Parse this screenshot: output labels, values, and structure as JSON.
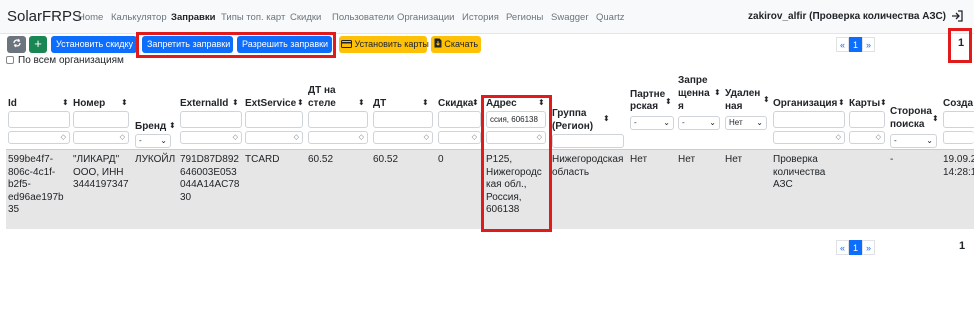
{
  "navbar": {
    "brand": "SolarFRPS",
    "items": [
      "Home",
      "Калькулятор",
      "Заправки",
      "Типы топ. карт",
      "Скидки",
      "Пользователи",
      "Организации",
      "История",
      "Регионы",
      "Swagger",
      "Quartz"
    ],
    "active_item": "Заправки",
    "user": "zakirov_alfir (Проверка количества АЗС)",
    "logout_icon": "logout-icon"
  },
  "toolbar": {
    "refresh_icon": "refresh-icon",
    "add_label": "+",
    "set_discount": "Установить скидку",
    "forbid_stations": "Запретить заправки",
    "allow_stations": "Разрешить заправки",
    "set_cards": "Установить карты",
    "download": "Скачать",
    "all_orgs_label": "По всем организациям"
  },
  "pagination": {
    "prev": "«",
    "current": "1",
    "next": "»",
    "total_pages": "1"
  },
  "table": {
    "columns": {
      "id": "Id",
      "number": "Номер",
      "brand": "Бренд",
      "external_id": "ExternalId",
      "ext_service": "ExtService",
      "dt_stela_1": "ДТ на",
      "dt_stela_2": "стеле",
      "dt": "ДТ",
      "discount": "Скидка",
      "address": "Адрес",
      "group_1": "Группа",
      "group_2": "(Регион)",
      "partner_1": "Партне",
      "partner_2": "рская",
      "forbidden_1": "Запре",
      "forbidden_2": "щенна",
      "forbidden_3": "я",
      "deleted_1": "Удален",
      "deleted_2": "ная",
      "organization": "Организация",
      "cards": "Карты",
      "side_1": "Сторона",
      "side_2": "поиска",
      "created": "Созда"
    },
    "filters": {
      "address_value": "ссия, 606138",
      "brand_select": "-",
      "partner_select": "-",
      "forbidden_select": "-",
      "deleted_select": "Нет",
      "side_select": "-"
    },
    "rows": [
      {
        "id": [
          "599be4f7-",
          "806c-4c1f-",
          "b2f5-",
          "ed96ae197b",
          "35"
        ],
        "number": [
          "\"ЛИКАРД\"",
          "ООО, ИНН",
          "3444197347"
        ],
        "brand": "ЛУКОЙЛ",
        "external_id": [
          "791D87D892",
          "646003E053",
          "044A14AC78",
          "30"
        ],
        "ext_service": "TCARD",
        "dt_stela": "60.52",
        "dt": "60.52",
        "discount": "0",
        "address": [
          "Р125,",
          "Нижегородс",
          "кая обл.,",
          "Россия,",
          "606138"
        ],
        "group": [
          "Нижегородская",
          "область"
        ],
        "partner": "Нет",
        "forbidden": "Нет",
        "deleted": "Нет",
        "organization": [
          "Проверка",
          "количества",
          "АЗС"
        ],
        "side": "-",
        "created": [
          "19.09.2",
          "14:28:1"
        ]
      }
    ]
  }
}
